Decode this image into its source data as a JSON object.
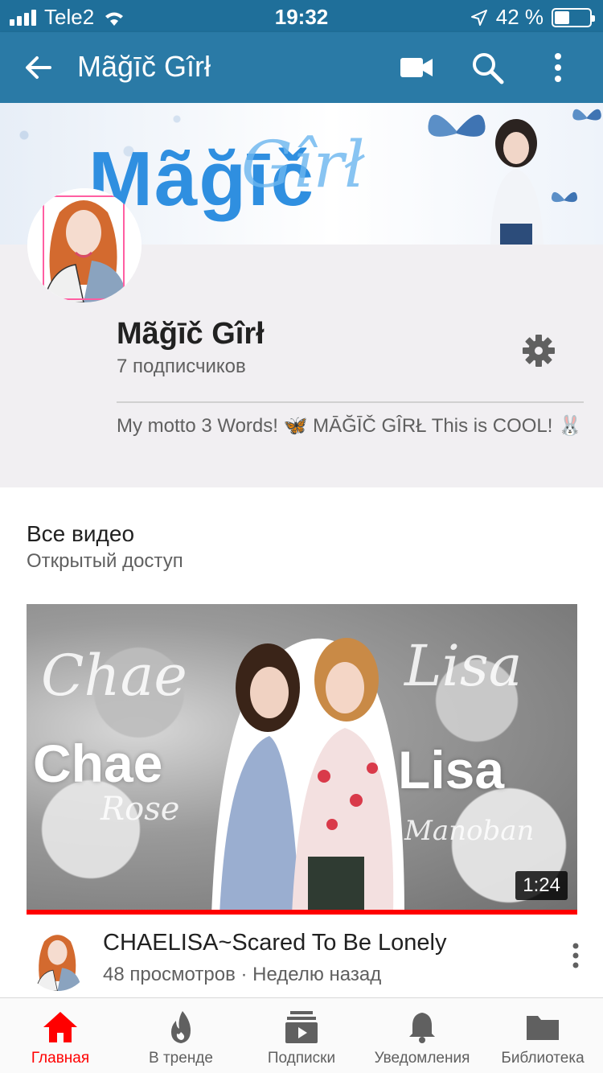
{
  "status_bar": {
    "carrier": "Tele2",
    "time": "19:32",
    "battery_percent": "42 %",
    "battery_level": 0.42
  },
  "app_bar": {
    "title": "Mãğīč Gîrł",
    "icons": [
      "back-arrow-icon",
      "video-camera-icon",
      "search-icon",
      "more-vert-icon"
    ]
  },
  "banner": {
    "text": "Mãğīč",
    "script_text": "Gîrł"
  },
  "channel": {
    "name": "Mãğīč Gîrł",
    "subscribers": "7 подписчиков",
    "motto": "My motto 3 Words! 🦋 MĀĞĪČ GÎRŁ This is COOL! 🐰"
  },
  "videos_section": {
    "title": "Все видео",
    "subtitle": "Открытый доступ"
  },
  "video": {
    "thumb_words": {
      "left_big": "Chae",
      "right_big": "Lisa",
      "left_script_top": "Chae",
      "right_script_top": "Lisa",
      "left_script_small": "Rose",
      "right_script_small": "Manoban"
    },
    "duration": "1:24",
    "progress": 1.0,
    "title": "CHAELISA~Scared To Be Lonely",
    "meta": "48 просмотров · Неделю назад"
  },
  "bottom_nav": {
    "items": [
      {
        "label": "Главная",
        "icon": "home-icon",
        "active": true
      },
      {
        "label": "В тренде",
        "icon": "flame-icon",
        "active": false
      },
      {
        "label": "Подписки",
        "icon": "subscriptions-icon",
        "active": false
      },
      {
        "label": "Уведомления",
        "icon": "bell-icon",
        "active": false
      },
      {
        "label": "Библиотека",
        "icon": "folder-icon",
        "active": false
      }
    ]
  },
  "colors": {
    "app_bar": "#2a7aa6",
    "status_bar": "#1f6f9a",
    "accent_red": "#ff0000"
  }
}
